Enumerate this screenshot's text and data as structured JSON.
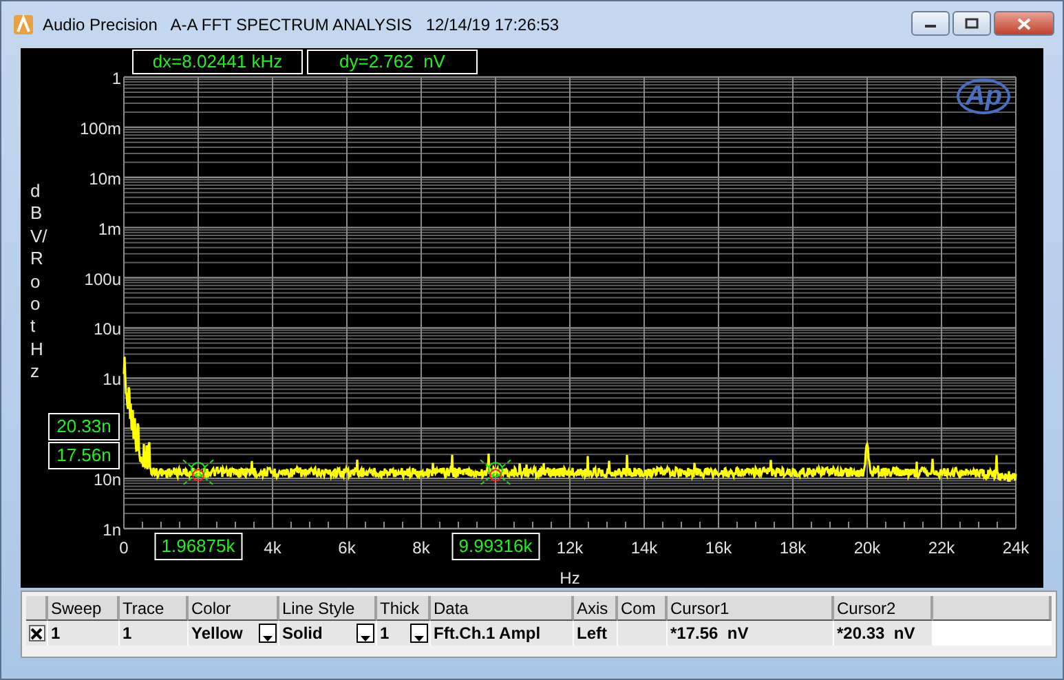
{
  "window": {
    "title": "Audio Precision   A-A FFT SPECTRUM ANALYSIS   12/14/19 17:26:53"
  },
  "plot": {
    "delta_readouts": [
      "dx=8.02441 kHz",
      "dy=2.762  nV"
    ],
    "logo": "Ap",
    "y_axis_label": "dBV/Root Hz",
    "x_axis_label": "Hz",
    "y_ticks": [
      {
        "label": "1"
      },
      {
        "label": "100m"
      },
      {
        "label": "10m"
      },
      {
        "label": "1m"
      },
      {
        "label": "100u"
      },
      {
        "label": "10u"
      },
      {
        "label": "1u"
      },
      {
        "cursor_readouts": [
          "20.33n",
          "17.56n"
        ]
      },
      {
        "label": "10n"
      },
      {
        "label": "1n"
      }
    ],
    "x_ticks": [
      {
        "label": "0"
      },
      {
        "cursor_readout": "1.96875k"
      },
      {
        "label": "4k"
      },
      {
        "label": "6k"
      },
      {
        "label": "8k"
      },
      {
        "cursor_readout": "9.99316k"
      },
      {
        "label": "12k"
      },
      {
        "label": "14k"
      },
      {
        "label": "16k"
      },
      {
        "label": "18k"
      },
      {
        "label": "20k"
      },
      {
        "label": "22k"
      },
      {
        "label": "24k"
      }
    ]
  },
  "table": {
    "columns": [
      "Sweep",
      "Trace",
      "Color",
      "Line Style",
      "Thick",
      "Data",
      "Axis",
      "Com",
      "Cursor1",
      "Cursor2"
    ],
    "rows": [
      {
        "checked": true,
        "cells": [
          {
            "kind": "plain",
            "text": "1"
          },
          {
            "kind": "plain",
            "text": "1"
          },
          {
            "kind": "dropdown",
            "text": "Yellow"
          },
          {
            "kind": "dropdown",
            "text": "Solid"
          },
          {
            "kind": "dropdown",
            "text": "1"
          },
          {
            "kind": "plain",
            "text": "Fft.Ch.1 Ampl"
          },
          {
            "kind": "plain",
            "text": "Left"
          },
          {
            "kind": "empty"
          },
          {
            "kind": "plain",
            "text": "*17.56  nV"
          },
          {
            "kind": "plain",
            "text": "*20.33  nV"
          }
        ]
      }
    ]
  }
}
